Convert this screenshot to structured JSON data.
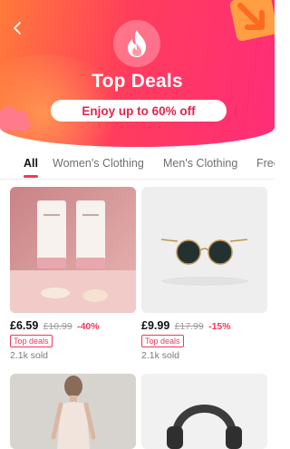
{
  "header": {
    "title": "Top Deals",
    "promo": "Enjoy up to  60% off",
    "back_icon": "chevron-left-icon",
    "logo_icon": "flame-icon"
  },
  "tabs": [
    {
      "label": "All",
      "active": true
    },
    {
      "label": "Women's Clothing",
      "active": false
    },
    {
      "label": "Men's Clothing",
      "active": false
    },
    {
      "label": "Free",
      "active": false
    }
  ],
  "products": [
    {
      "name": "Skincare tubes",
      "price": "£6.59",
      "old_price": "£10.99",
      "discount": "-40%",
      "badge": "Top deals",
      "sold": "2.1k sold"
    },
    {
      "name": "Round sunglasses",
      "price": "£9.99",
      "old_price": "£17.99",
      "discount": "-15%",
      "badge": "Top deals",
      "sold": "2.1k sold"
    },
    {
      "name": "Dress",
      "price": "",
      "old_price": "",
      "discount": "",
      "badge": "",
      "sold": ""
    },
    {
      "name": "Headphones",
      "price": "",
      "old_price": "",
      "discount": "",
      "badge": "",
      "sold": ""
    }
  ],
  "colors": {
    "brand_red": "#f2385a",
    "header_gradient_start": "#ff7a3a",
    "header_gradient_end": "#ff2d78"
  }
}
